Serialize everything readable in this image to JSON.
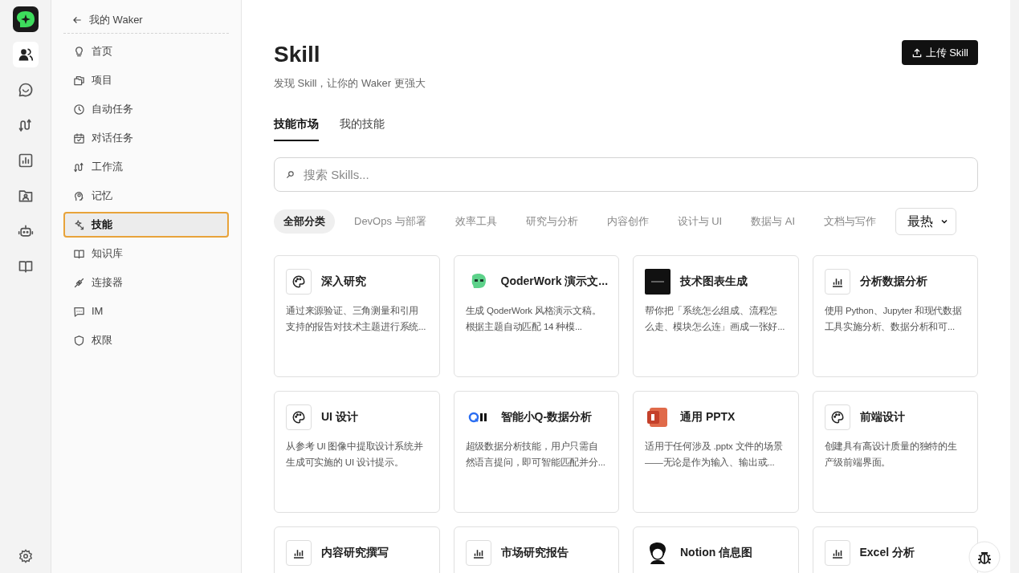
{
  "sidebar": {
    "back": "我的 Waker",
    "items": [
      {
        "label": "首页",
        "selected": false
      },
      {
        "label": "项目",
        "selected": false
      },
      {
        "label": "自动任务",
        "selected": false
      },
      {
        "label": "对话任务",
        "selected": false
      },
      {
        "label": "工作流",
        "selected": false
      },
      {
        "label": "记忆",
        "selected": false
      },
      {
        "label": "技能",
        "selected": true
      },
      {
        "label": "知识库",
        "selected": false
      },
      {
        "label": "连接器",
        "selected": false
      },
      {
        "label": "IM",
        "selected": false
      },
      {
        "label": "权限",
        "selected": false
      }
    ]
  },
  "rail": [
    {
      "selected": true
    },
    {
      "selected": false
    },
    {
      "selected": false
    },
    {
      "selected": false
    },
    {
      "selected": false
    },
    {
      "selected": false
    },
    {
      "selected": false
    }
  ],
  "header": {
    "title": "Skill",
    "subtitle": "发现 Skill，让你的 Waker 更强大",
    "upload_button": "上传 Skill"
  },
  "tabs": [
    {
      "label": "技能市场",
      "selected": true
    },
    {
      "label": "我的技能",
      "selected": false
    }
  ],
  "search": {
    "placeholder": "搜索 Skills..."
  },
  "filters": [
    {
      "label": "全部分类",
      "selected": true
    },
    {
      "label": "DevOps 与部署",
      "selected": false
    },
    {
      "label": "效率工具",
      "selected": false
    },
    {
      "label": "研究与分析",
      "selected": false
    },
    {
      "label": "内容创作",
      "selected": false
    },
    {
      "label": "设计与 UI",
      "selected": false
    },
    {
      "label": "数据与 AI",
      "selected": false
    },
    {
      "label": "文档与写作",
      "selected": false
    }
  ],
  "sort": {
    "value": "最热"
  },
  "cards": [
    {
      "kind": "palette",
      "title": "深入研究",
      "description": "通过来源验证、三角测量和引用支持的报告对技术主题进行系统..."
    },
    {
      "kind": "qoder",
      "title": "QoderWork 演示文...",
      "description": "生成 QoderWork 风格演示文稿。根据主题自动匹配 14 种模..."
    },
    {
      "kind": "drafter",
      "title": "技术图表生成",
      "description": "帮你把「系统怎么组成、流程怎么走、模块怎么连」画成一张好..."
    },
    {
      "kind": "chart",
      "title": "分析数据分析",
      "description": "使用 Python、Jupyter 和现代数据工具实施分析、数据分析和可..."
    },
    {
      "kind": "palette",
      "title": "UI 设计",
      "description": "从参考 UI 图像中提取设计系统并生成可实施的 UI 设计提示。"
    },
    {
      "kind": "qbi",
      "title": "智能小Q-数据分析",
      "description": "超级数据分析技能，用户只需自然语言提问，即可智能匹配并分..."
    },
    {
      "kind": "pptx",
      "title": "通用 PPTX",
      "description": "适用于任何涉及 .pptx 文件的场景——无论是作为输入、输出或..."
    },
    {
      "kind": "palette",
      "title": "前端设计",
      "description": "创建具有高设计质量的独特的生产级前端界面。"
    },
    {
      "kind": "chart",
      "title": "内容研究撰写"
    },
    {
      "kind": "chart",
      "title": "市场研究报告"
    },
    {
      "kind": "notion",
      "title": "Notion 信息图"
    },
    {
      "kind": "chart",
      "title": "Excel 分析"
    }
  ]
}
